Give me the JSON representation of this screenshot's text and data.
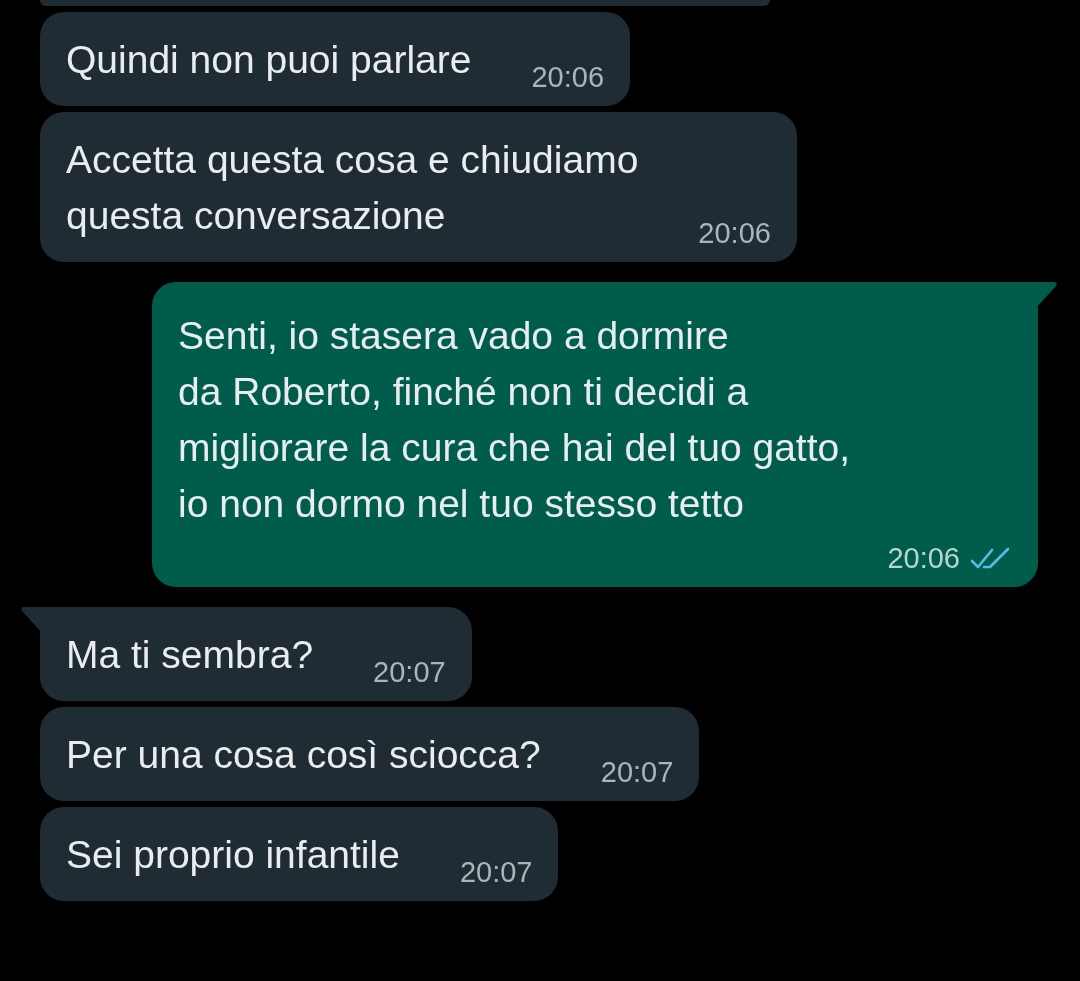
{
  "messages": [
    {
      "kind": "in",
      "tail": false,
      "text": "Quindi non puoi parlare",
      "time": "20:06"
    },
    {
      "kind": "in",
      "tail": false,
      "text": "Accetta questa cosa e chiudiamo\nquesta conversazione",
      "time": "20:06"
    },
    {
      "kind": "out",
      "tail": true,
      "text": "Senti, io stasera vado a dormire\nda Roberto, finché non ti decidi a\nmigliorare la cura che hai del tuo gatto,\nio non dormo nel tuo stesso tetto",
      "time": "20:06",
      "read": true
    },
    {
      "kind": "in",
      "tail": true,
      "text": "Ma ti sembra?",
      "time": "20:07"
    },
    {
      "kind": "in",
      "tail": false,
      "text": "Per una cosa così sciocca?",
      "time": "20:07"
    },
    {
      "kind": "in",
      "tail": false,
      "text": "Sei proprio infantile",
      "time": "20:07"
    }
  ]
}
